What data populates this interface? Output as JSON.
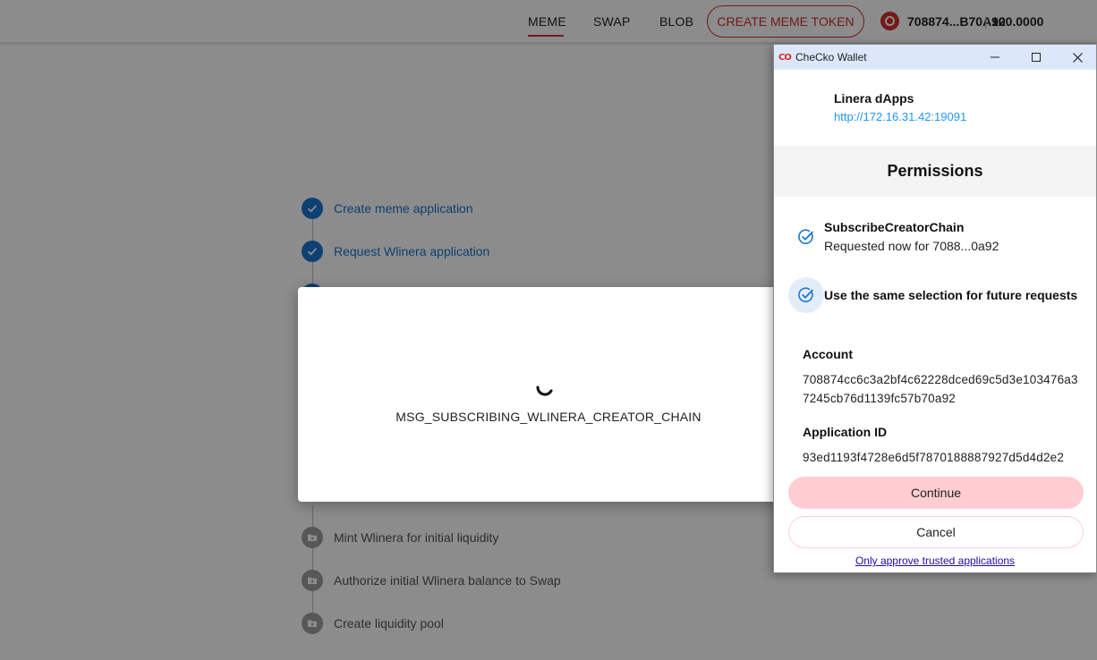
{
  "header": {
    "nav": [
      "MEME",
      "SWAP",
      "BLOB"
    ],
    "create_button": "CREATE MEME TOKEN",
    "account": {
      "address": "708874...B70A92",
      "separator": "|",
      "balance": "100.0000"
    }
  },
  "steps": {
    "step1": "Create meme application",
    "step2": "Request Wlinera application",
    "step7": "Mint Wlinera for initial liquidity",
    "step8": "Authorize initial Wlinera balance to Swap",
    "step9": "Create liquidity pool"
  },
  "loading": {
    "message": "MSG_SUBSCRIBING_WLINERA_CREATOR_CHAIN"
  },
  "wallet": {
    "title": "CheCko Wallet",
    "logo_text": "CO",
    "dapp": {
      "name": "Linera dApps",
      "url": "http://172.16.31.42:19091"
    },
    "permissions_title": "Permissions",
    "permission": {
      "name": "SubscribeCreatorChain",
      "desc": "Requested now for 7088...0a92"
    },
    "same_selection_label": "Use the same selection for future requests",
    "account_label": "Account",
    "account_value": "708874cc6c3a2bf4c62228dced69c5d3e103476a37245cb76d1139fc57b70a92",
    "app_id_label": "Application ID",
    "app_id_value": "93ed1193f4728e6d5f7870188887927d5d4d2e2",
    "continue_label": "Continue",
    "cancel_label": "Cancel",
    "trusted_link": "Only approve trusted applications"
  },
  "colors": {
    "brand_red": "#d32f2f",
    "step_done": "#1976d2",
    "continue_bg": "#ffcdd2",
    "link_blue": "#2196f3",
    "titlebar_bg": "#dce8fa"
  }
}
